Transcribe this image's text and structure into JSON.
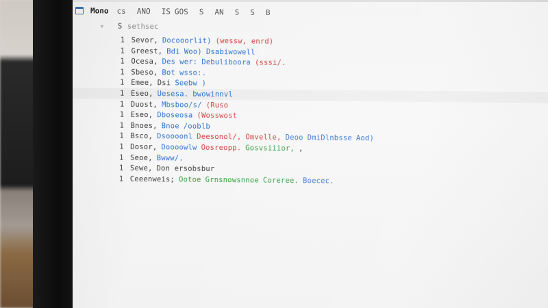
{
  "toolbar": {
    "title": "Mono",
    "items": [
      "cs",
      "ANO",
      "IS",
      "GOS",
      "S",
      "AN",
      "S",
      "S",
      "B"
    ]
  },
  "editor": {
    "header": {
      "gutter": "S",
      "label": "sethsec"
    },
    "lines": [
      {
        "gutter": "1",
        "tokens": [
          {
            "t": "Sevor,",
            "c": "kw"
          },
          {
            "t": "Docooorlit)",
            "c": "blue"
          },
          {
            "t": "(wessw, enrd)",
            "c": "red"
          }
        ]
      },
      {
        "gutter": "1",
        "tokens": [
          {
            "t": "Greest,",
            "c": "kw"
          },
          {
            "t": "Bdi",
            "c": "blue"
          },
          {
            "t": "Woo)",
            "c": "blue"
          },
          {
            "t": "Dsabiwowell",
            "c": "blue"
          }
        ]
      },
      {
        "gutter": "1",
        "tokens": [
          {
            "t": "Ocesa,",
            "c": "kw"
          },
          {
            "t": "Des",
            "c": "blue"
          },
          {
            "t": "wer:",
            "c": "blue"
          },
          {
            "t": "Debuliboora",
            "c": "blue"
          },
          {
            "t": "(sssi/.",
            "c": "red"
          }
        ]
      },
      {
        "gutter": "1",
        "tokens": [
          {
            "t": "Sbeso,",
            "c": "kw"
          },
          {
            "t": "Bot",
            "c": "blue"
          },
          {
            "t": "wsso:.",
            "c": "blue"
          }
        ]
      },
      {
        "gutter": "1",
        "tokens": [
          {
            "t": "Emee,",
            "c": "kw"
          },
          {
            "t": "Dsi",
            "c": "kw"
          },
          {
            "t": "Seebw )",
            "c": "blue"
          }
        ]
      },
      {
        "gutter": "1",
        "tokens": [
          {
            "t": "Eseo,",
            "c": "kw"
          },
          {
            "t": "Uesesa.",
            "c": "blue"
          },
          {
            "t": "bwowinnvl",
            "c": "blue"
          }
        ],
        "highlight": true
      },
      {
        "gutter": "1",
        "tokens": [
          {
            "t": "Duost,",
            "c": "kw"
          },
          {
            "t": "Mbsboo/s/",
            "c": "blue"
          },
          {
            "t": "(Ruso",
            "c": "red"
          }
        ]
      },
      {
        "gutter": "1",
        "tokens": [
          {
            "t": "Eseo,",
            "c": "kw"
          },
          {
            "t": "Dboseosa",
            "c": "blue"
          },
          {
            "t": "(Wosswost",
            "c": "red"
          }
        ]
      },
      {
        "gutter": "1",
        "tokens": [
          {
            "t": "Bnoes,",
            "c": "kw"
          },
          {
            "t": "Bnoe",
            "c": "blue"
          },
          {
            "t": "/ooblb",
            "c": "blue"
          }
        ]
      },
      {
        "gutter": "1",
        "tokens": [
          {
            "t": "Bsco,",
            "c": "kw"
          },
          {
            "t": "Dsoooonl",
            "c": "blue"
          },
          {
            "t": "Deesonol/,",
            "c": "red"
          },
          {
            "t": "Omvelle,",
            "c": "red"
          },
          {
            "t": "Deoo",
            "c": "blue"
          },
          {
            "t": "DmiDlnbsse",
            "c": "blue"
          },
          {
            "t": "Aod)",
            "c": "blue"
          }
        ]
      },
      {
        "gutter": "1",
        "tokens": [
          {
            "t": "Dosor,",
            "c": "kw"
          },
          {
            "t": "Doooowlw",
            "c": "blue"
          },
          {
            "t": "Oosreopp.",
            "c": "red"
          },
          {
            "t": "Gosvsiiior,",
            "c": "green"
          },
          {
            "t": ",",
            "c": "kw"
          }
        ]
      },
      {
        "gutter": "1",
        "tokens": [
          {
            "t": "Seoe,",
            "c": "kw"
          },
          {
            "t": "Bwww/.",
            "c": "blue"
          }
        ]
      },
      {
        "gutter": "1",
        "tokens": [
          {
            "t": "Sewe,",
            "c": "kw"
          },
          {
            "t": "Don ersobsbur",
            "c": "kw"
          }
        ]
      },
      {
        "gutter": "1",
        "tokens": [
          {
            "t": "Ceeenweis;",
            "c": "kw"
          },
          {
            "t": "Ootoe",
            "c": "green"
          },
          {
            "t": "Grnsnowsnnoe",
            "c": "green"
          },
          {
            "t": "Coreree.",
            "c": "green"
          },
          {
            "t": "Boecec.",
            "c": "blue"
          }
        ]
      }
    ]
  }
}
